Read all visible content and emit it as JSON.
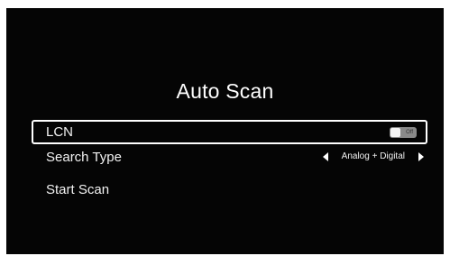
{
  "screen": {
    "title": "Auto Scan"
  },
  "menu": {
    "items": [
      {
        "label": "LCN",
        "toggle_state": "Off",
        "focused": true
      },
      {
        "label": "Search Type",
        "value": "Analog + Digital"
      },
      {
        "label": "Start Scan"
      }
    ]
  },
  "colors": {
    "background": "#050505",
    "text": "#ffffff",
    "toggle_track": "#8a8a8a",
    "focus_border": "#ffffff"
  },
  "icons": {
    "prev": "triangle-left-icon",
    "next": "triangle-right-icon"
  }
}
